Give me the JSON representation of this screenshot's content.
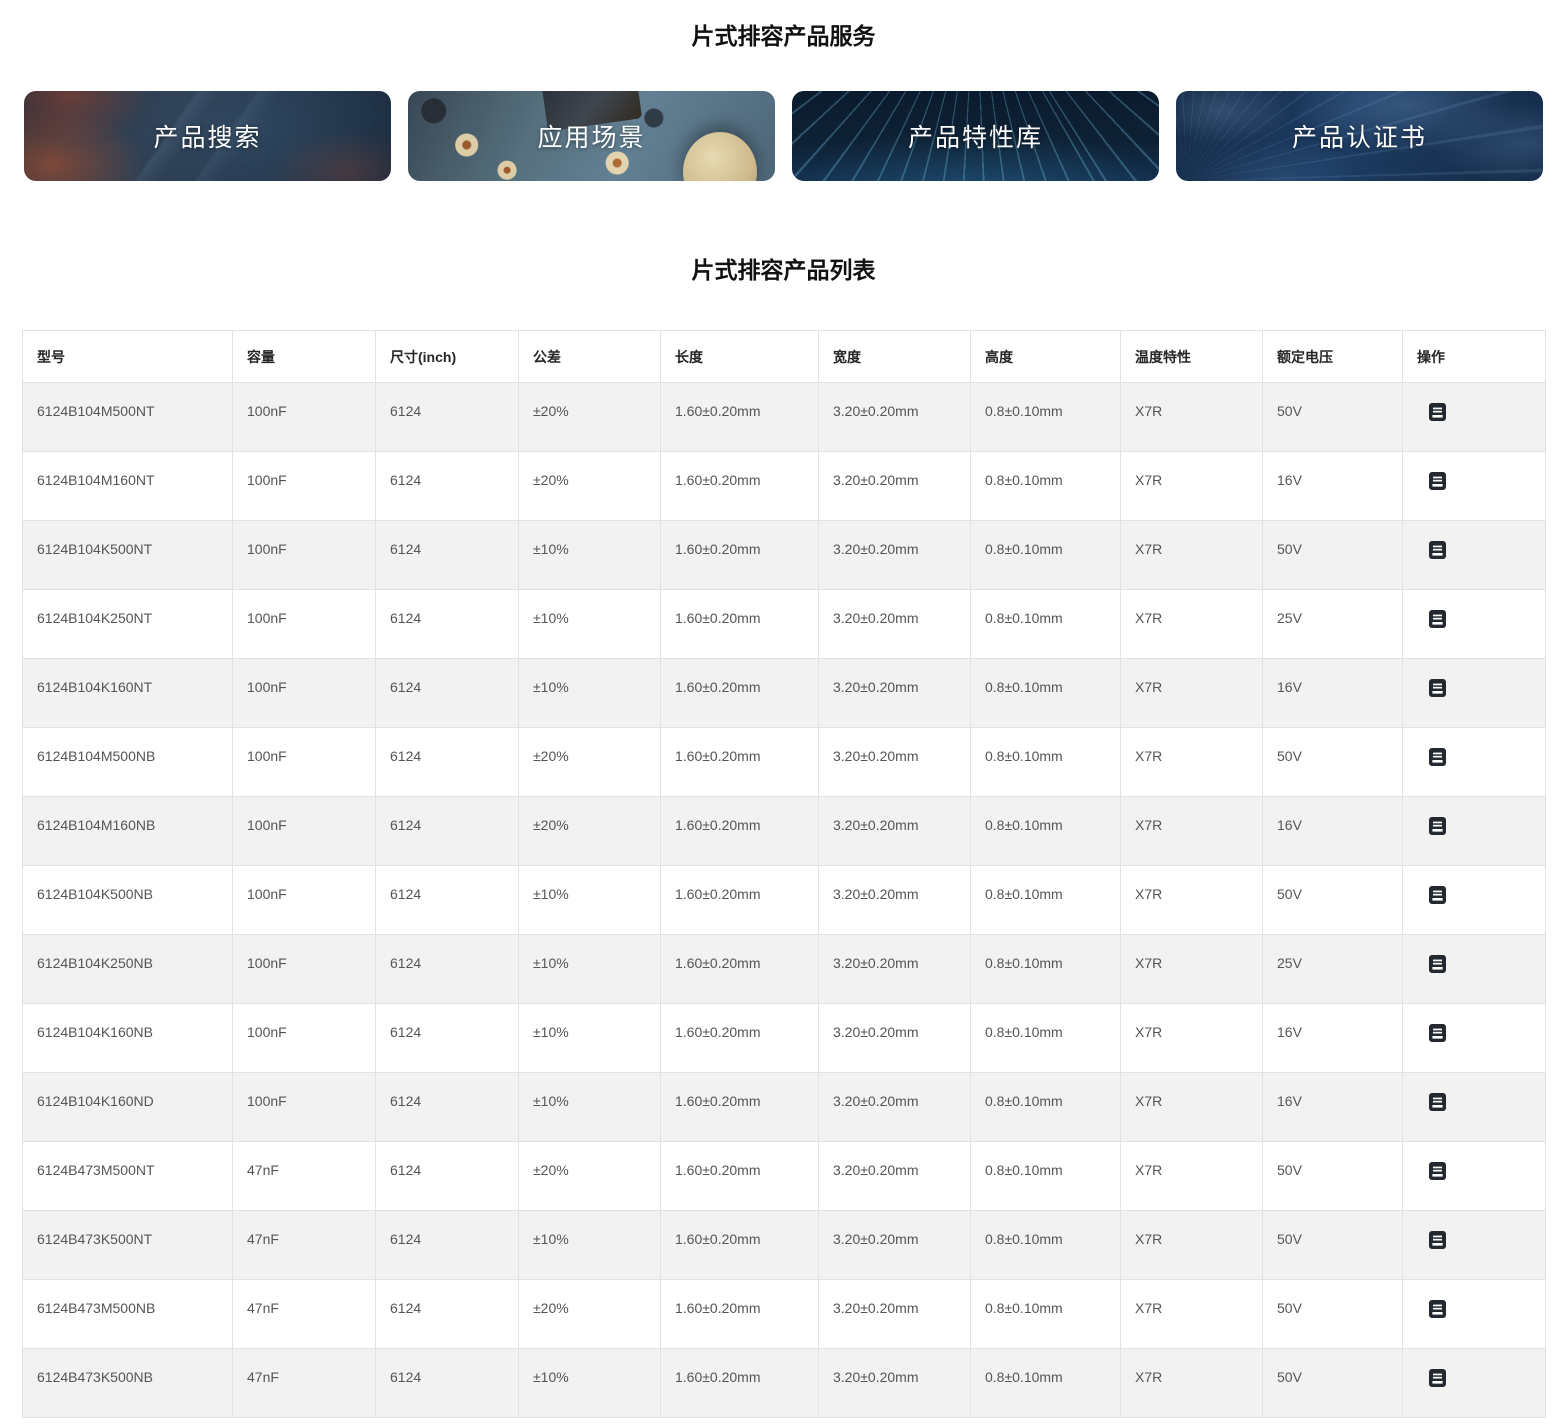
{
  "page": {
    "services_title": "片式排容产品服务",
    "list_title": "片式排容产品列表"
  },
  "service_cards": [
    {
      "label": "产品搜索"
    },
    {
      "label": "应用场景"
    },
    {
      "label": "产品特性库"
    },
    {
      "label": "产品认证书"
    }
  ],
  "table": {
    "columns": [
      "型号",
      "容量",
      "尺寸(inch)",
      "公差",
      "长度",
      "宽度",
      "高度",
      "温度特性",
      "额定电压",
      "操作"
    ],
    "action_icon": "document-icon",
    "rows": [
      {
        "model": "6124B104M500NT",
        "capacity": "100nF",
        "size": "6124",
        "tolerance": "±20%",
        "length": "1.60±0.20mm",
        "width": "3.20±0.20mm",
        "height": "0.8±0.10mm",
        "temp": "X7R",
        "voltage": "50V"
      },
      {
        "model": "6124B104M160NT",
        "capacity": "100nF",
        "size": "6124",
        "tolerance": "±20%",
        "length": "1.60±0.20mm",
        "width": "3.20±0.20mm",
        "height": "0.8±0.10mm",
        "temp": "X7R",
        "voltage": "16V"
      },
      {
        "model": "6124B104K500NT",
        "capacity": "100nF",
        "size": "6124",
        "tolerance": "±10%",
        "length": "1.60±0.20mm",
        "width": "3.20±0.20mm",
        "height": "0.8±0.10mm",
        "temp": "X7R",
        "voltage": "50V"
      },
      {
        "model": "6124B104K250NT",
        "capacity": "100nF",
        "size": "6124",
        "tolerance": "±10%",
        "length": "1.60±0.20mm",
        "width": "3.20±0.20mm",
        "height": "0.8±0.10mm",
        "temp": "X7R",
        "voltage": "25V"
      },
      {
        "model": "6124B104K160NT",
        "capacity": "100nF",
        "size": "6124",
        "tolerance": "±10%",
        "length": "1.60±0.20mm",
        "width": "3.20±0.20mm",
        "height": "0.8±0.10mm",
        "temp": "X7R",
        "voltage": "16V"
      },
      {
        "model": "6124B104M500NB",
        "capacity": "100nF",
        "size": "6124",
        "tolerance": "±20%",
        "length": "1.60±0.20mm",
        "width": "3.20±0.20mm",
        "height": "0.8±0.10mm",
        "temp": "X7R",
        "voltage": "50V"
      },
      {
        "model": "6124B104M160NB",
        "capacity": "100nF",
        "size": "6124",
        "tolerance": "±20%",
        "length": "1.60±0.20mm",
        "width": "3.20±0.20mm",
        "height": "0.8±0.10mm",
        "temp": "X7R",
        "voltage": "16V"
      },
      {
        "model": "6124B104K500NB",
        "capacity": "100nF",
        "size": "6124",
        "tolerance": "±10%",
        "length": "1.60±0.20mm",
        "width": "3.20±0.20mm",
        "height": "0.8±0.10mm",
        "temp": "X7R",
        "voltage": "50V"
      },
      {
        "model": "6124B104K250NB",
        "capacity": "100nF",
        "size": "6124",
        "tolerance": "±10%",
        "length": "1.60±0.20mm",
        "width": "3.20±0.20mm",
        "height": "0.8±0.10mm",
        "temp": "X7R",
        "voltage": "25V"
      },
      {
        "model": "6124B104K160NB",
        "capacity": "100nF",
        "size": "6124",
        "tolerance": "±10%",
        "length": "1.60±0.20mm",
        "width": "3.20±0.20mm",
        "height": "0.8±0.10mm",
        "temp": "X7R",
        "voltage": "16V"
      },
      {
        "model": "6124B104K160ND",
        "capacity": "100nF",
        "size": "6124",
        "tolerance": "±10%",
        "length": "1.60±0.20mm",
        "width": "3.20±0.20mm",
        "height": "0.8±0.10mm",
        "temp": "X7R",
        "voltage": "16V"
      },
      {
        "model": "6124B473M500NT",
        "capacity": "47nF",
        "size": "6124",
        "tolerance": "±20%",
        "length": "1.60±0.20mm",
        "width": "3.20±0.20mm",
        "height": "0.8±0.10mm",
        "temp": "X7R",
        "voltage": "50V"
      },
      {
        "model": "6124B473K500NT",
        "capacity": "47nF",
        "size": "6124",
        "tolerance": "±10%",
        "length": "1.60±0.20mm",
        "width": "3.20±0.20mm",
        "height": "0.8±0.10mm",
        "temp": "X7R",
        "voltage": "50V"
      },
      {
        "model": "6124B473M500NB",
        "capacity": "47nF",
        "size": "6124",
        "tolerance": "±20%",
        "length": "1.60±0.20mm",
        "width": "3.20±0.20mm",
        "height": "0.8±0.10mm",
        "temp": "X7R",
        "voltage": "50V"
      },
      {
        "model": "6124B473K500NB",
        "capacity": "47nF",
        "size": "6124",
        "tolerance": "±10%",
        "length": "1.60±0.20mm",
        "width": "3.20±0.20mm",
        "height": "0.8±0.10mm",
        "temp": "X7R",
        "voltage": "50V"
      }
    ]
  },
  "colors": {
    "row_stripe": "#f2f2f2",
    "table_border": "#e2e2e2",
    "card_text": "#ffffff",
    "icon_dark": "#24292f"
  }
}
